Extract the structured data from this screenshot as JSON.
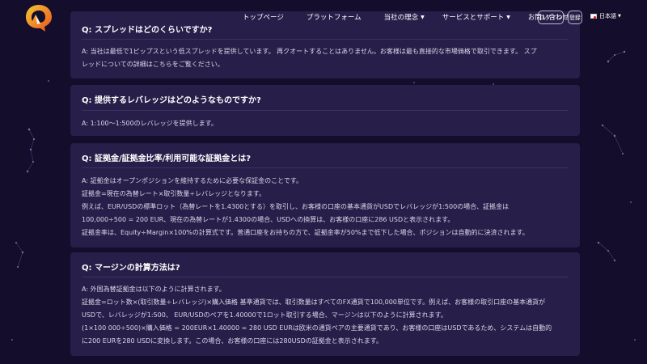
{
  "nav": {
    "items": [
      {
        "label": "トップページ",
        "dropdown": false
      },
      {
        "label": "プラットフォーム",
        "dropdown": false
      },
      {
        "label": "当社の理念",
        "dropdown": true
      },
      {
        "label": "サービスとサポート",
        "dropdown": true
      },
      {
        "label": "お問い合わせ",
        "dropdown": false
      }
    ],
    "login_label": "ログイン",
    "register_label": "登録",
    "language_label": "日本語"
  },
  "faq": [
    {
      "question": "Q: スプレッドはどのくらいですか?",
      "answer_lines": [
        "A: 当社は最低で1ピップスという低スプレッドを提供しています。 再クオートすることはありません。お客様は最も直接的な市場価格で取引できます。 スプ",
        "レッドについての詳細はこちらをご覧ください。"
      ]
    },
    {
      "question": "Q: 提供するレバレッジはどのようなものですか?",
      "answer_lines": [
        "A: 1:100～1:500のレバレッジを提供します。"
      ]
    },
    {
      "question": "Q: 証拠金/証拠金比率/利用可能な証拠金とは?",
      "answer_lines": [
        "A: 証拠金はオープンポジションを維持するために必要な保証金のことです。",
        "証拠金=現在の為替レート×取引数量÷レバレッジとなります。",
        "例えば、EUR/USDの標準ロット（為替レートを1.4300とする）を取引し、お客様の口座の基本通貨がUSDでレバレッジが1:500の場合、証拠金は",
        "100,000÷500 = 200 EUR、現在の為替レートが1.4300の場合、USDへの換算は、お客様の口座に286 USDと表示されます。",
        "証拠金率は、Equity÷Margin×100%の計算式です。普通口座をお持ちの方で、証拠金率が50%まで低下した場合、ポジションは自動的に決済されます。"
      ]
    },
    {
      "question": "Q: マージンの計算方法は?",
      "answer_lines": [
        "A: 外国為替証拠金は以下のように計算されます。",
        "証拠金=ロット数×(取引数量÷レバレッジ)×購入価格 基準通貨では、取引数量はすべてのFX通貨で100,000単位です。例えば、お客様の取引口座の基本通貨が",
        "USDで、レバレッジが1:500、 EUR/USDのペアを1.40000で1ロット取引する場合、マージンは以下のように計算されます。",
        "(1×100 000÷500)×購入価格 = 200EUR×1.40000 = 280 USD EURは欧米の通貨ペアの主要通貨であり、お客様の口座はUSDであるため、システムは自動的",
        "に200 EURを280 USDに変換します。この場合、お客様の口座には280USDの証拠金と表示されます。"
      ]
    }
  ]
}
